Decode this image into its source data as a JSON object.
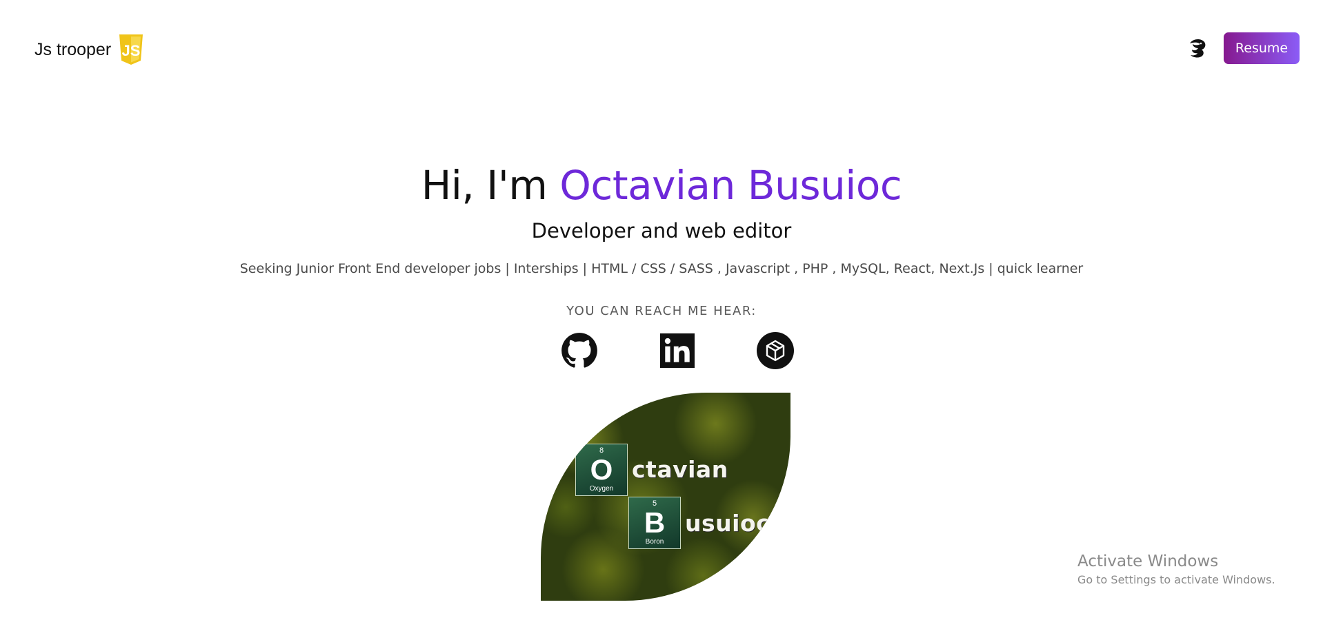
{
  "header": {
    "brand_text": "Js trooper",
    "brand_badge_text": "JS",
    "theme_toggle_icon": "dragon-icon",
    "resume_label": "Resume"
  },
  "hero": {
    "greeting": "Hi, I'm",
    "name": "Octavian Busuioc",
    "subtitle": "Developer and web editor",
    "tagline": "Seeking Junior Front End developer jobs | Interships | HTML / CSS / SASS , Javascript , PHP , MySQL, React, Next.Js | quick learner",
    "reach_label": "YOU CAN REACH ME HEAR:"
  },
  "social": [
    {
      "name": "GitHub",
      "icon": "github-icon"
    },
    {
      "name": "LinkedIn",
      "icon": "linkedin-icon"
    },
    {
      "name": "CodePen",
      "icon": "codepen-icon"
    }
  ],
  "avatar": {
    "tile1": {
      "number": "8",
      "symbol": "O",
      "name": "Oxygen"
    },
    "word1": "ctavian",
    "tile2": {
      "number": "5",
      "symbol": "B",
      "name": "Boron"
    },
    "word2": "usuioc"
  },
  "watermark": {
    "title": "Activate Windows",
    "subtitle": "Go to Settings to activate Windows."
  },
  "colors": {
    "accent": "#6d28d9",
    "resume_gradient_start": "#86198f",
    "resume_gradient_end": "#8b5cf6",
    "js_yellow": "#f0c419"
  }
}
